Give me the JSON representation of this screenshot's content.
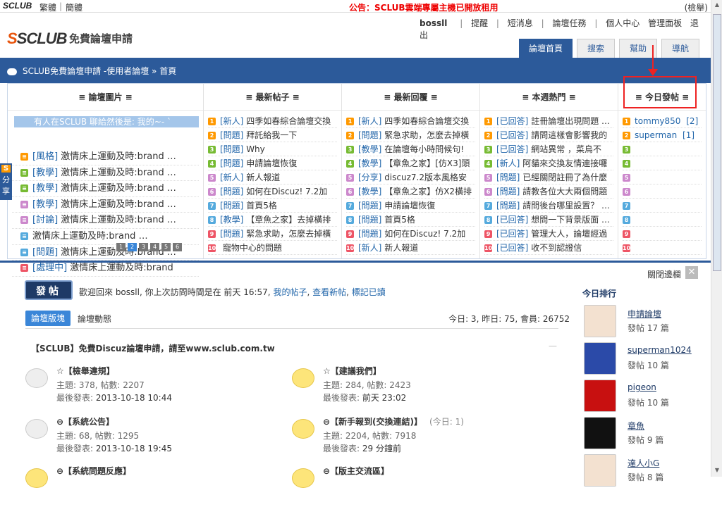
{
  "topbar": {
    "brand": "SCLUB",
    "lang_trad": "繁體",
    "lang_simp": "簡體",
    "notice": "公告：SCLUB雲端專屬主機已開放租用",
    "report": "(檢舉)"
  },
  "header": {
    "logo": "SCLUB",
    "logo_sub": "免費論壇申請"
  },
  "usernav": {
    "user": "bossll",
    "items": [
      "提醒",
      "短消息",
      "論壇任務",
      "個人中心",
      "管理面板",
      "退出"
    ]
  },
  "navtabs": [
    "論壇首頁",
    "搜索",
    "幫助",
    "導航"
  ],
  "breadcrumb": "SCLUB免費論壇申請 -使用者論壇 » 首頁",
  "share": {
    "s": "S",
    "label": "分享"
  },
  "hot": {
    "col1": {
      "title": "≡ 論壇圖片 ≡",
      "ticker": "有人在SCLUB 聊給然後是: 我的~- `",
      "rows": [
        [
          "[風格]",
          "激情床上運動及時:brand …"
        ],
        [
          "[教學]",
          "激情床上運動及時:brand …"
        ],
        [
          "[教學]",
          "激情床上運動及時:brand …"
        ],
        [
          "[教學]",
          "激情床上運動及時:brand …"
        ],
        [
          "[討論]",
          "激情床上運動及時:brand …"
        ],
        [
          "",
          "激情床上運動及時:brand …"
        ],
        [
          "[問題]",
          "激情床上運動及時:brand …"
        ],
        [
          "[處理中]",
          "激情床上運動及時:brand"
        ]
      ],
      "pager": [
        "1",
        "2",
        "3",
        "4",
        "5",
        "6"
      ]
    },
    "col2": {
      "title": "≡ 最新帖子 ≡",
      "rows": [
        [
          "[新人]",
          "四季如春綜合論壇交換"
        ],
        [
          "[問題]",
          "拜託給我一下"
        ],
        [
          "[問題]",
          "Why"
        ],
        [
          "[問題]",
          "申請論壇恢復"
        ],
        [
          "[新人]",
          "新人報道"
        ],
        [
          "[問題]",
          "如何在Discuz! 7.2加"
        ],
        [
          "[問題]",
          "首頁5格"
        ],
        [
          "[教學]",
          "【章魚之家】去掉橫排"
        ],
        [
          "[問題]",
          "緊急求助，怎麼去掉橫"
        ],
        [
          "",
          "寵物中心的問題"
        ]
      ]
    },
    "col3": {
      "title": "≡ 最新回覆 ≡",
      "rows": [
        [
          "[新人]",
          "四季如春綜合論壇交換"
        ],
        [
          "[問題]",
          "緊急求助，怎麼去掉橫"
        ],
        [
          "[教學]",
          "在論壇每小時問候句!"
        ],
        [
          "[教學]",
          "【章魚之家】[仿X3]頭"
        ],
        [
          "[分享]",
          "discuz7.2版本風格安"
        ],
        [
          "[教學]",
          "【章魚之家】仿X2橫排"
        ],
        [
          "[問題]",
          "申請論壇恢復"
        ],
        [
          "[問題]",
          "首頁5格"
        ],
        [
          "[問題]",
          "如何在Discuz! 7.2加"
        ],
        [
          "[新人]",
          "新人報道"
        ]
      ]
    },
    "col4": {
      "title": "≡ 本週熱門 ≡",
      "rows": [
        [
          "[已回答]",
          "註冊論壇出現問題 …"
        ],
        [
          "[已回答]",
          "請問這樣會影響我的"
        ],
        [
          "[已回答]",
          "網站異常 ，菜鳥不"
        ],
        [
          "[新人]",
          "阿貓來交換友情連接囉"
        ],
        [
          "[問題]",
          "已經關閉註冊了為什麼"
        ],
        [
          "[問題]",
          "請教各位大大兩個問題"
        ],
        [
          "[問題]",
          "請問後台哪里設置？ …"
        ],
        [
          "[已回答]",
          "想問一下背景版面 …"
        ],
        [
          "[已回答]",
          "管理大人，論壇經過"
        ],
        [
          "[已回答]",
          "收不到認證信"
        ]
      ]
    },
    "col5": {
      "title": "≡ 今日發帖 ≡",
      "rows": [
        [
          "tommy850",
          "[2]"
        ],
        [
          "superman",
          "[1]"
        ],
        [
          "",
          ""
        ],
        [
          "",
          ""
        ],
        [
          "",
          ""
        ],
        [
          "",
          ""
        ],
        [
          "",
          ""
        ],
        [
          "",
          ""
        ],
        [
          "",
          ""
        ],
        [
          "",
          ""
        ]
      ]
    }
  },
  "main": {
    "close_sidebar": "關閉邊欄",
    "close_x": "✕",
    "post_btn": "發帖",
    "welcome": "歡迎回來 bossll, 你上次訪問時間是在 前天 16:57,",
    "my_posts": "我的帖子",
    "new_posts": "查看新帖",
    "mark_read": "標記已讀",
    "tab_forums": "論壇版塊",
    "tab_activity": "論壇動態",
    "stats": "今日: 3, 昨日: 75, 會員: 26752",
    "section_title": "【SCLUB】免費Discuz論壇申請，請至www.sclub.com.tw",
    "forums": [
      {
        "name": "☆【檢舉違規】",
        "stat": "主題: 378, 帖數: 2207",
        "last_label": "最後發表:",
        "last": "2013-10-18 10:44",
        "today": ""
      },
      {
        "name": "☆【建議我們】",
        "stat": "主題: 284, 帖數: 2423",
        "last_label": "最後發表:",
        "last": "前天 23:02",
        "today": ""
      },
      {
        "name": "⊖【系統公告】",
        "stat": "主題: 68, 帖數: 1295",
        "last_label": "最後發表:",
        "last": "2013-10-18 19:45",
        "today": ""
      },
      {
        "name": "⊖【新手報到(交換連結)】",
        "stat": "主題: 2204, 帖數: 7918",
        "last_label": "最後發表:",
        "last": "29 分鐘前",
        "today": "(今日: 1)"
      },
      {
        "name": "⊖【系統問題反應】",
        "stat": "",
        "last_label": "",
        "last": "",
        "today": ""
      },
      {
        "name": "⊖【版主交流區】",
        "stat": "",
        "last_label": "",
        "last": "",
        "today": ""
      }
    ]
  },
  "rank": {
    "title": "今日排行",
    "users": [
      {
        "name": "申請論壇",
        "count": "發帖 17 篇"
      },
      {
        "name": "superman1024",
        "count": "發帖 10 篇"
      },
      {
        "name": "pigeon",
        "count": "發帖 10 篇"
      },
      {
        "name": "章魚",
        "count": "發帖 9 篇"
      },
      {
        "name": "達人小G",
        "count": "發帖 8 篇"
      }
    ]
  },
  "colors": {
    "nav_blue": "#2c5a9a",
    "accent_red": "#e22",
    "link_blue": "#2266aa"
  }
}
